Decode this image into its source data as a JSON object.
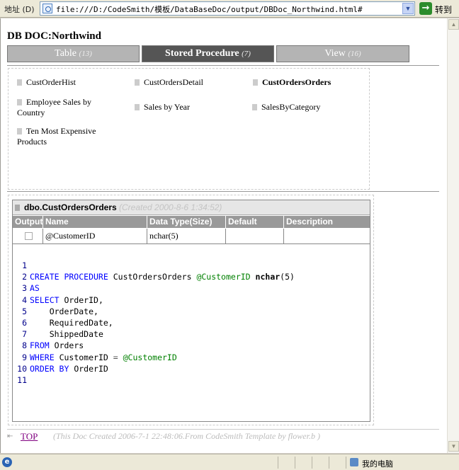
{
  "browser": {
    "address_label": "地址 (D)",
    "address_url": "file:///D:/CodeSmith/模板/DataBaseDoc/output/DBDoc_Northwind.html#",
    "go_label": "转到",
    "status_zone": "我的电脑"
  },
  "doc": {
    "title": "DB DOC:Northwind",
    "tabs": [
      {
        "label": "Table",
        "count": "(13)",
        "active": false
      },
      {
        "label": "Stored Procedure",
        "count": "(7)",
        "active": true
      },
      {
        "label": "View",
        "count": "(16)",
        "active": false
      }
    ],
    "procedures": [
      {
        "label": "CustOrderHist"
      },
      {
        "label": "CustOrdersDetail"
      },
      {
        "label": "CustOrdersOrders",
        "current": true
      },
      {
        "label": "Employee Sales by Country"
      },
      {
        "label": "Sales by Year"
      },
      {
        "label": "SalesByCategory"
      },
      {
        "label": "Ten Most Expensive Products"
      }
    ]
  },
  "detail": {
    "name": "dbo.CustOrdersOrders",
    "created": "(Created 2000-8-6 1:34:52)",
    "columns": [
      "Output",
      "Name",
      "Data Type(Size)",
      "Default",
      "Description"
    ],
    "params": [
      {
        "output": false,
        "name": "@CustomerID",
        "type": "nchar(5)",
        "default": "",
        "description": ""
      }
    ],
    "code_lines": [
      {
        "n": "1"
      },
      {
        "n": "2"
      },
      {
        "n": "3"
      },
      {
        "n": "4"
      },
      {
        "n": "5"
      },
      {
        "n": "6"
      },
      {
        "n": "7"
      },
      {
        "n": "8"
      },
      {
        "n": "9"
      },
      {
        "n": "10"
      },
      {
        "n": "11"
      }
    ],
    "code": {
      "l2_kw": "CREATE PROCEDURE",
      "l2_name": "CustOrdersOrders",
      "l2_param": "@CustomerID",
      "l2_type": "nchar",
      "l2_size": "(5)",
      "l3_kw": "AS",
      "l4_kw": "SELECT",
      "l4_rest": "OrderID,",
      "l5": "OrderDate,",
      "l6": "RequiredDate,",
      "l7": "ShippedDate",
      "l8_kw": "FROM",
      "l8_rest": "Orders",
      "l9_kw": "WHERE",
      "l9_col": "CustomerID",
      "l9_op": "=",
      "l9_param": "@CustomerID",
      "l10_kw": "ORDER BY",
      "l10_rest": "OrderID"
    }
  },
  "footer": {
    "top_link": "TOP",
    "note": "(This Doc Created 2006-7-1 22:48:06.From CodeSmith Template by flower.b )"
  }
}
